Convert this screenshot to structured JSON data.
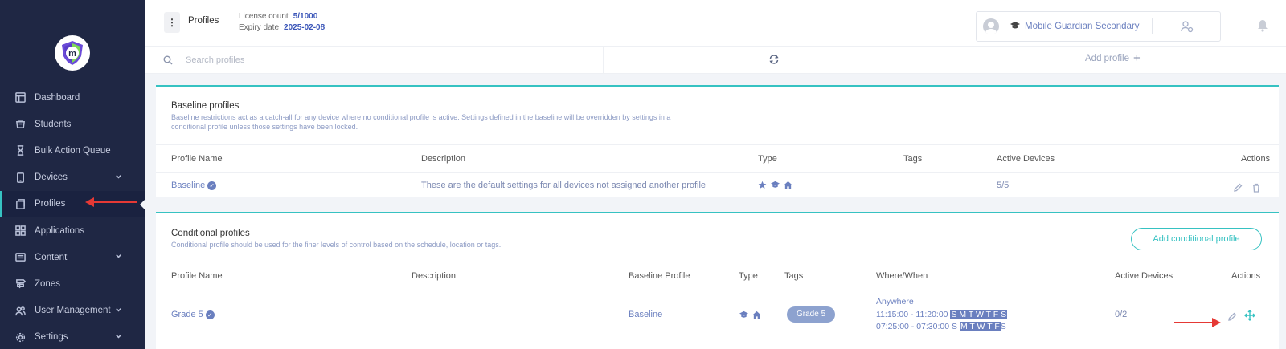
{
  "sidebar": {
    "items": [
      {
        "label": "Dashboard"
      },
      {
        "label": "Students"
      },
      {
        "label": "Bulk Action Queue"
      },
      {
        "label": "Devices"
      },
      {
        "label": "Profiles"
      },
      {
        "label": "Applications"
      },
      {
        "label": "Content"
      },
      {
        "label": "Zones"
      },
      {
        "label": "User Management"
      },
      {
        "label": "Settings"
      }
    ],
    "active": "Profiles"
  },
  "header": {
    "page_label": "Profiles",
    "license_count_label": "License count",
    "license_count_value": "5/1000",
    "expiry_label": "Expiry date",
    "expiry_value": "2025-02-08",
    "org_name": "Mobile Guardian Secondary"
  },
  "search": {
    "placeholder": "Search profiles",
    "add_profile_label": "Add profile"
  },
  "baseline": {
    "title": "Baseline profiles",
    "description": "Baseline restrictions act as a catch-all for any device where no conditional profile is active. Settings defined in the baseline will be overridden by settings in a conditional profile unless those settings have been locked.",
    "columns": {
      "name": "Profile Name",
      "description": "Description",
      "type": "Type",
      "tags": "Tags",
      "active_devices": "Active Devices",
      "actions": "Actions"
    },
    "rows": [
      {
        "name": "Baseline",
        "description": "These are the default settings for all devices not assigned another profile",
        "type_icons": [
          "star-icon",
          "graduation-cap-icon",
          "home-icon"
        ],
        "active_devices": "5/5"
      }
    ]
  },
  "conditional": {
    "title": "Conditional profiles",
    "description": "Conditional profile should be used for the finer levels of control based on the schedule, location or tags.",
    "add_button_label": "Add conditional profile",
    "columns": {
      "name": "Profile Name",
      "description": "Description",
      "baseline": "Baseline Profile",
      "type": "Type",
      "tags": "Tags",
      "where_when": "Where/When",
      "active_devices": "Active Devices",
      "actions": "Actions"
    },
    "rows": [
      {
        "name": "Grade 5",
        "baseline": "Baseline",
        "type_icons": [
          "graduation-cap-icon",
          "home-icon"
        ],
        "tag": "Grade 5",
        "where": "Anywhere",
        "schedule1_time": "11:15:00 - 11:20:00",
        "schedule1_days": "S M T W T F S",
        "schedule2_time": "07:25:00 - 07:30:00",
        "schedule2_day_off": "S",
        "schedule2_days": "M T W T F",
        "schedule2_day_off_end": "S",
        "active_devices": "0/2"
      }
    ]
  },
  "colors": {
    "sidebar_bg": "#1f2744",
    "accent_teal": "#36c2c2",
    "link_blue": "#6a7fbf",
    "annotation_red": "#e53935"
  }
}
